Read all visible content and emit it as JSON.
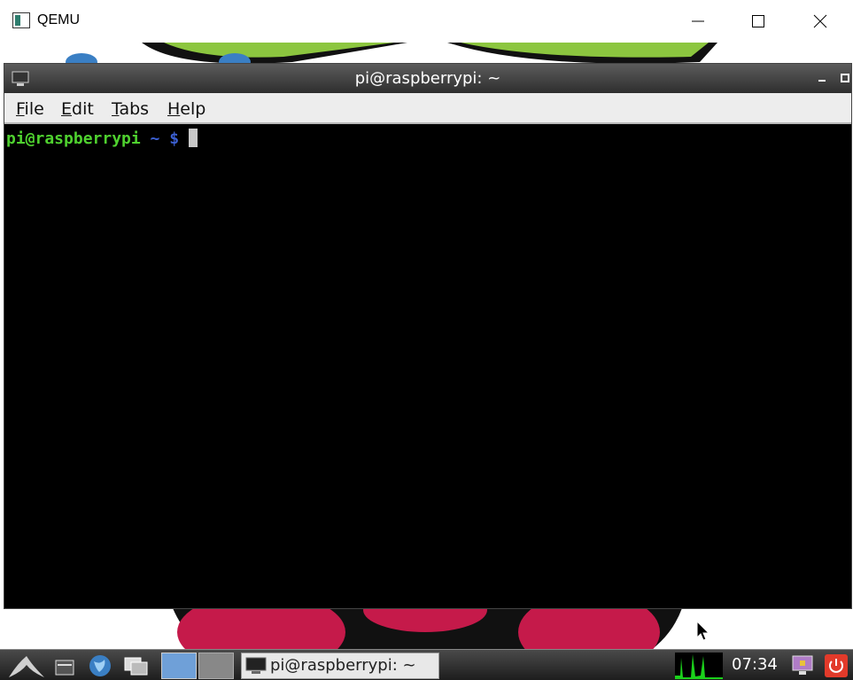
{
  "host_window": {
    "title": "QEMU",
    "icons": {
      "app": "qemu-app-icon",
      "minimize": "minimize-icon",
      "maximize": "maximize-icon",
      "close": "close-icon"
    }
  },
  "terminal": {
    "title": "pi@raspberrypi: ~",
    "menu": [
      {
        "label_first": "F",
        "label_rest": "ile"
      },
      {
        "label_first": "E",
        "label_rest": "dit"
      },
      {
        "label_first": "T",
        "label_rest": "abs"
      },
      {
        "label_first": "H",
        "label_rest": "elp"
      }
    ],
    "prompt": {
      "user_host": "pi@raspberrypi",
      "path": " ~ $ "
    },
    "colors": {
      "prompt_user": "#4fd12f",
      "prompt_path": "#3b5fd1"
    }
  },
  "taskbar": {
    "task_label": "pi@raspberrypi: ~",
    "clock": "07:34",
    "icons": [
      "start-menu-icon",
      "file-manager-icon",
      "web-browser-icon",
      "show-desktop-icon",
      "workspace-1-icon",
      "workspace-2-icon",
      "cpu-monitor-icon",
      "lock-screen-icon",
      "shutdown-icon"
    ]
  }
}
